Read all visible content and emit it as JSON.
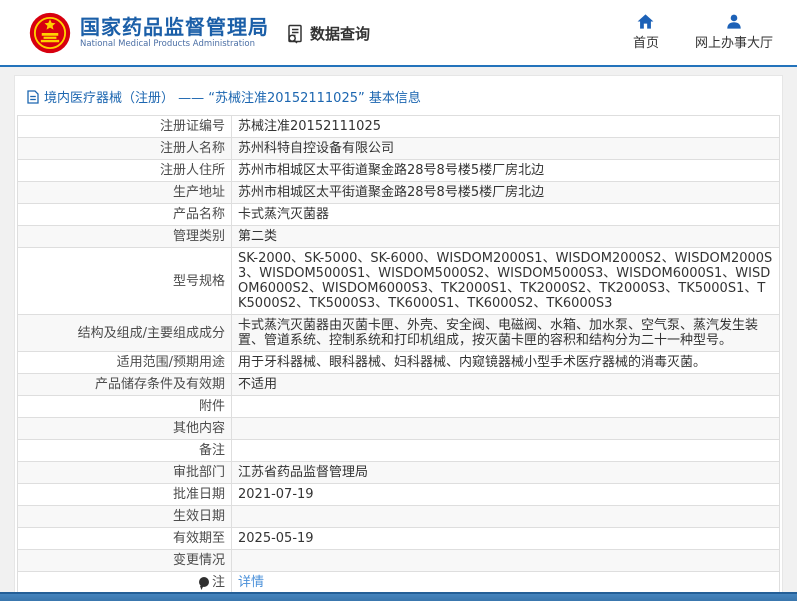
{
  "header": {
    "agency_name_cn": "国家药品监督管理局",
    "agency_name_en": "National Medical Products Administration",
    "section_label": "数据查询",
    "nav": [
      {
        "label": "首页",
        "icon": "home-icon"
      },
      {
        "label": "网上办事大厅",
        "icon": "person-icon"
      }
    ]
  },
  "breadcrumb": {
    "text": "境内医疗器械（注册） —— “苏械注准20152111025” 基本信息"
  },
  "table": {
    "rows": [
      {
        "label": "注册证编号",
        "value": "苏械注准20152111025"
      },
      {
        "label": "注册人名称",
        "value": "苏州科特自控设备有限公司"
      },
      {
        "label": "注册人住所",
        "value": "苏州市相城区太平街道聚金路28号8号楼5楼厂房北边"
      },
      {
        "label": "生产地址",
        "value": "苏州市相城区太平街道聚金路28号8号楼5楼厂房北边"
      },
      {
        "label": "产品名称",
        "value": "卡式蒸汽灭菌器"
      },
      {
        "label": "管理类别",
        "value": "第二类"
      },
      {
        "label": "型号规格",
        "value": "SK-2000、SK-5000、SK-6000、WISDOM2000S1、WISDOM2000S2、WISDOM2000S3、WISDOM5000S1、WISDOM5000S2、WISDOM5000S3、WISDOM6000S1、WISDOM6000S2、WISDOM6000S3、TK2000S1、TK2000S2、TK2000S3、TK5000S1、TK5000S2、TK5000S3、TK6000S1、TK6000S2、TK6000S3"
      },
      {
        "label": "结构及组成/主要组成成分",
        "value": "卡式蒸汽灭菌器由灭菌卡匣、外壳、安全阀、电磁阀、水箱、加水泵、空气泵、蒸汽发生装置、管道系统、控制系统和打印机组成，按灭菌卡匣的容积和结构分为二十一种型号。"
      },
      {
        "label": "适用范围/预期用途",
        "value": "用于牙科器械、眼科器械、妇科器械、内窥镜器械小型手术医疗器械的消毒灭菌。"
      },
      {
        "label": "产品储存条件及有效期",
        "value": "不适用"
      },
      {
        "label": "附件",
        "value": ""
      },
      {
        "label": "其他内容",
        "value": ""
      },
      {
        "label": "备注",
        "value": ""
      },
      {
        "label": "审批部门",
        "value": "江苏省药品监督管理局"
      },
      {
        "label": "批准日期",
        "value": "2021-07-19"
      },
      {
        "label": "生效日期",
        "value": ""
      },
      {
        "label": "有效期至",
        "value": "2025-05-19"
      },
      {
        "label": "变更情况",
        "value": ""
      },
      {
        "label": "注",
        "value": "详情",
        "link": true,
        "icon": "balloon-icon"
      }
    ]
  },
  "colors": {
    "header_title_blue": "#1b5fa8",
    "header_rule_blue": "#2373bb",
    "nav_icon_blue": "#1c61b7",
    "breadcrumb_blue": "#1c66b0",
    "link_blue": "#4a90d9",
    "emblem_red": "#d7000f",
    "emblem_gold": "#ffd100",
    "footer_blue": "#3a76ad",
    "row_alt_bg": "#f8f8f8",
    "table_border": "#dedede"
  }
}
